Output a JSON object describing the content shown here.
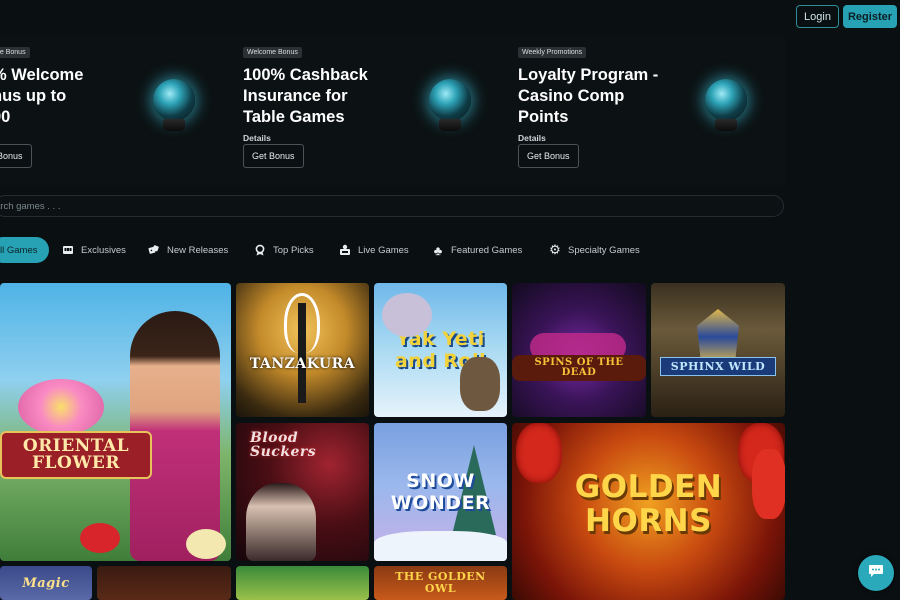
{
  "header": {
    "login_label": "Login",
    "register_label": "Register"
  },
  "promos": [
    {
      "badge": "ne Bonus",
      "title_lines": [
        "% Welcome",
        "nus up to",
        "00"
      ],
      "details": "s",
      "button": "Bonus"
    },
    {
      "badge": "Welcome Bonus",
      "title_lines": [
        "100% Cashback",
        "Insurance for",
        "Table Games"
      ],
      "details": "Details",
      "button": "Get Bonus"
    },
    {
      "badge": "Weekly Promotions",
      "title_lines": [
        "Loyalty Program -",
        "Casino Comp",
        "Points"
      ],
      "details": "Details",
      "button": "Get Bonus"
    }
  ],
  "search": {
    "placeholder": "arch games . . ."
  },
  "tabs": [
    {
      "label": "ll Games",
      "icon": "grid-icon"
    },
    {
      "label": "Exclusives",
      "icon": "slot-machine-icon"
    },
    {
      "label": "New Releases",
      "icon": "dice-icon"
    },
    {
      "label": "Top Picks",
      "icon": "trophy-icon"
    },
    {
      "label": "Live Games",
      "icon": "dealer-icon"
    },
    {
      "label": "Featured Games",
      "icon": "clubs-icon"
    },
    {
      "label": "Specialty Games",
      "icon": "gear-icon"
    }
  ],
  "games": {
    "oriental_flower": "ORIENTAL FLOWER",
    "tanzakura": "TANZAKURA",
    "yak_yeti_roll": "Yak Yeti and Roll",
    "spins_of_the_dead": "SPINS of the DEAD",
    "sphinx_wild": "SPHINX WILD",
    "blood_suckers": "Blood Suckers",
    "snow_wonder": "SNOW WONDER",
    "golden_horns": "GOLDEN HORNS",
    "magic": "Magic",
    "golden_owl": "THE GOLDEN OWL"
  },
  "colors": {
    "accent": "#27a2b4",
    "background": "#0a0f11"
  }
}
